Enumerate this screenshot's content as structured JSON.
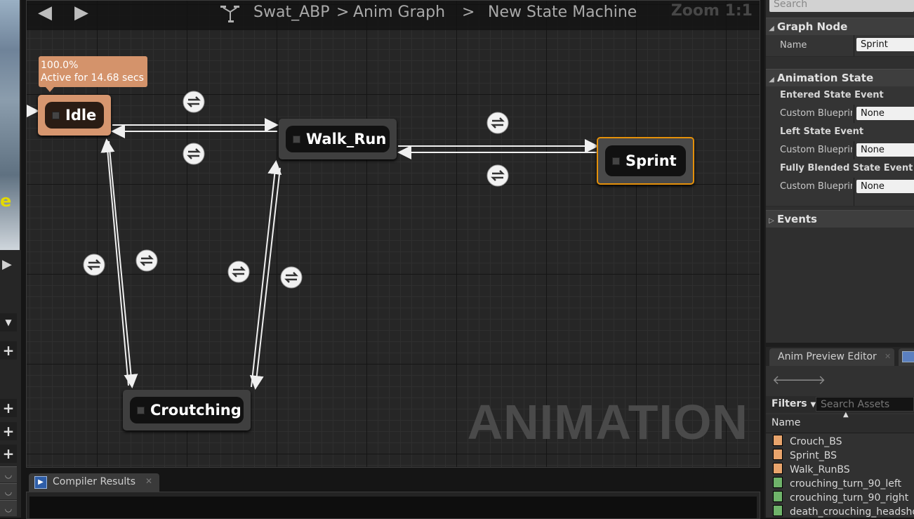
{
  "breadcrumb": {
    "asset": "Swat_ABP",
    "graph": "Anim Graph",
    "machine": "New State Machine",
    "sep1": ">",
    "sep2": ">"
  },
  "zoom_label": "Zoom 1:1",
  "watermark": "ANIMATION",
  "idle_tooltip": {
    "weight": "100.0%",
    "active": "Active for 14.68 secs"
  },
  "states": {
    "idle": "Idle",
    "walk_run": "Walk_Run",
    "sprint": "Sprint",
    "crouching": "Croutching"
  },
  "left_thumb_text": "e",
  "compiler_tab": "Compiler Results",
  "details": {
    "search_placeholder": "Search",
    "graph_node_header": "Graph Node",
    "name_label": "Name",
    "name_value": "Sprint",
    "animation_state_header": "Animation State",
    "entered_event": "Entered State Event",
    "left_event": "Left State Event",
    "blended_event": "Fully Blended State Event",
    "custom_blueprint_label": "Custom Blueprint Event",
    "none_value": "None",
    "events_header": "Events"
  },
  "anim_preview": {
    "tab": "Anim Preview Editor",
    "filters": "Filters",
    "search_placeholder": "Search Assets",
    "name_col": "Name",
    "assets": [
      {
        "name": "Crouch_BS",
        "kind": "blendspace"
      },
      {
        "name": "Sprint_BS",
        "kind": "blendspace"
      },
      {
        "name": "Walk_RunBS",
        "kind": "blendspace"
      },
      {
        "name": "crouching_turn_90_left",
        "kind": "sequence"
      },
      {
        "name": "crouching_turn_90_right",
        "kind": "sequence"
      },
      {
        "name": "death_crouching_headshot",
        "kind": "sequence"
      }
    ]
  },
  "colors": {
    "idle_state": "#d6966f",
    "sprint_border": "#e4900a",
    "blendspace_icon": "#e8a46c",
    "sequence_icon": "#6fb36a"
  }
}
